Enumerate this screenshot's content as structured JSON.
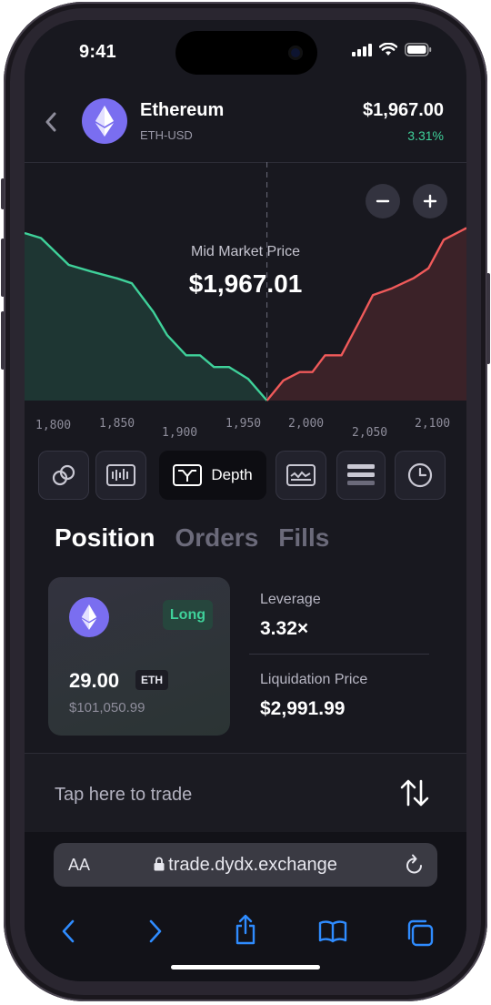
{
  "status_bar": {
    "time": "9:41"
  },
  "market": {
    "name": "Ethereum",
    "pair": "ETH-USD",
    "price": "$1,967.00",
    "change": "3.31%",
    "icon": "ethereum-icon"
  },
  "chart": {
    "mid_label": "Mid Market Price",
    "mid_value": "$1,967.01"
  },
  "chart_data": {
    "type": "area",
    "title": "",
    "x_ticks": [
      "1,800",
      "1,850",
      "1,900",
      "1,950",
      "2,000",
      "2,050",
      "2,100"
    ],
    "xlim": [
      1775,
      2125
    ],
    "mid": 1967,
    "series": [
      {
        "side": "bids",
        "color": "#3fd19a",
        "points": [
          [
            1775,
            1.0
          ],
          [
            1788,
            0.97
          ],
          [
            1810,
            0.81
          ],
          [
            1828,
            0.77
          ],
          [
            1848,
            0.73
          ],
          [
            1860,
            0.7
          ],
          [
            1877,
            0.53
          ],
          [
            1888,
            0.39
          ],
          [
            1903,
            0.27
          ],
          [
            1914,
            0.27
          ],
          [
            1925,
            0.2
          ],
          [
            1937,
            0.2
          ],
          [
            1952,
            0.13
          ],
          [
            1967,
            0.0
          ]
        ]
      },
      {
        "side": "asks",
        "color": "#f05a5a",
        "points": [
          [
            1967,
            0.0
          ],
          [
            1980,
            0.12
          ],
          [
            1993,
            0.17
          ],
          [
            2003,
            0.17
          ],
          [
            2013,
            0.27
          ],
          [
            2026,
            0.27
          ],
          [
            2040,
            0.47
          ],
          [
            2051,
            0.63
          ],
          [
            2066,
            0.67
          ],
          [
            2083,
            0.73
          ],
          [
            2095,
            0.79
          ],
          [
            2107,
            0.96
          ],
          [
            2125,
            1.03
          ]
        ]
      }
    ]
  },
  "views": [
    {
      "icon": "link-icon"
    },
    {
      "icon": "candles-icon"
    },
    {
      "icon": "depth-icon",
      "label": "Depth"
    },
    {
      "icon": "line-chart-icon"
    },
    {
      "icon": "orderbook-icon"
    },
    {
      "icon": "clock-icon"
    }
  ],
  "tabs": [
    "Position",
    "Orders",
    "Fills"
  ],
  "position": {
    "side": "Long",
    "size": "29.00",
    "unit": "ETH",
    "notional": "$101,050.99",
    "leverage_label": "Leverage",
    "leverage_value": "3.32×",
    "liq_label": "Liquidation Price",
    "liq_value": "$2,991.99"
  },
  "trade": {
    "label": "Tap here to trade"
  },
  "browser": {
    "aa": "AA",
    "url": "trade.dydx.exchange"
  },
  "colors": {
    "accent": "#7a6ef0",
    "positive": "#3fd19a",
    "negative": "#f05a5a"
  }
}
